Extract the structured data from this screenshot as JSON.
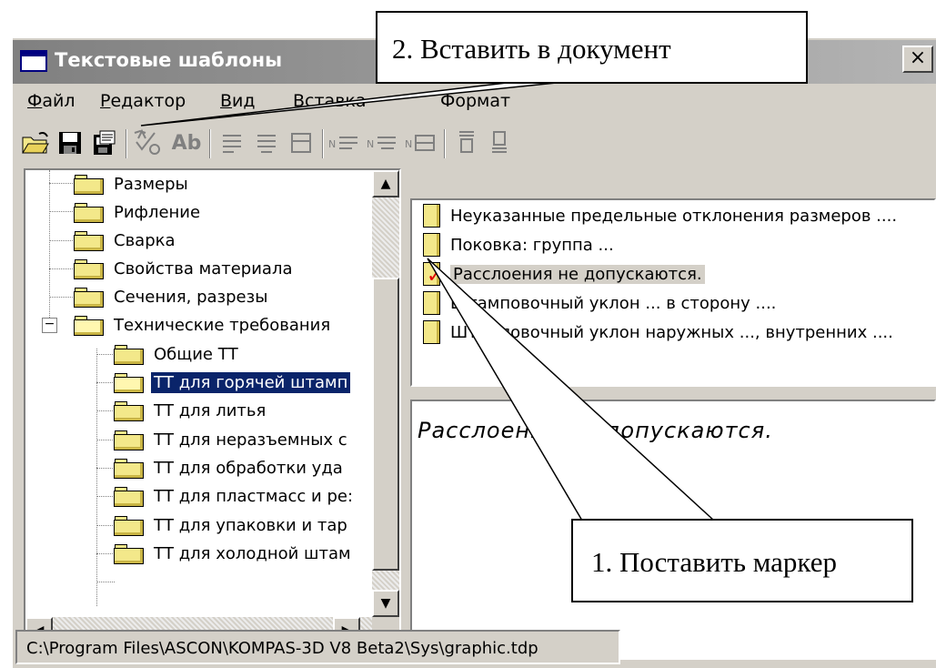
{
  "window": {
    "title": "Текстовые шаблоны",
    "close_label": "×"
  },
  "menu": [
    {
      "label": "Файл",
      "acc": "Ф",
      "rest": "айл"
    },
    {
      "label": "Редактор",
      "acc": "Р",
      "rest": "едактор"
    },
    {
      "label": "Вид",
      "acc": "В",
      "rest": "ид"
    },
    {
      "label": "Вставка",
      "acc": "",
      "rest": "Вставка"
    },
    {
      "label": "Формат",
      "acc": "",
      "rest": "Формат"
    }
  ],
  "toolbar": {
    "ab_label": "Ab",
    "icons": [
      "open-folder-icon",
      "save-icon",
      "insert-into-document-icon",
      "spellcheck-icon",
      "font-icon",
      "align-left-icon",
      "align-center-icon",
      "align-right-icon",
      "numbered-left-icon",
      "numbered-center-icon",
      "numbered-right-icon",
      "align-top-icon",
      "align-bottom-icon"
    ]
  },
  "tree": {
    "items": [
      {
        "label": "Размеры",
        "level": 1
      },
      {
        "label": "Рифление",
        "level": 1
      },
      {
        "label": "Сварка",
        "level": 1
      },
      {
        "label": "Свойства материала",
        "level": 1
      },
      {
        "label": "Сечения, разрезы",
        "level": 1
      },
      {
        "label": "Технические требования",
        "level": 1,
        "expander": "−"
      },
      {
        "label": "Общие ТТ",
        "level": 2
      },
      {
        "label": "ТТ для горячей штамп",
        "level": 2,
        "selected": true
      },
      {
        "label": "ТТ для литья",
        "level": 2
      },
      {
        "label": "ТТ для неразъемных с",
        "level": 2
      },
      {
        "label": "ТТ для обработки уда",
        "level": 2
      },
      {
        "label": "ТТ для пластмасс и ре:",
        "level": 2
      },
      {
        "label": "ТТ для упаковки и тар",
        "level": 2
      },
      {
        "label": "ТТ для холодной штам",
        "level": 2
      }
    ]
  },
  "list": {
    "items": [
      {
        "label": "Неуказанные предельные отклонения размеров ...."
      },
      {
        "label": "Поковка: группа ..."
      },
      {
        "label": "Расслоения не допускаются.",
        "marked": true
      },
      {
        "label": "Штамповочный уклон ... в сторону ...."
      },
      {
        "label": "Штамповочный уклон наружных ..., внутренних ...."
      }
    ]
  },
  "preview": {
    "text": "Расслоения не допускаются."
  },
  "status": {
    "path": "C:\\Program Files\\ASCON\\KOMPAS-3D V8 Beta2\\Sys\\graphic.tdp"
  },
  "callouts": {
    "insert": "2. Вставить в документ",
    "marker": "1. Поставить маркер"
  }
}
